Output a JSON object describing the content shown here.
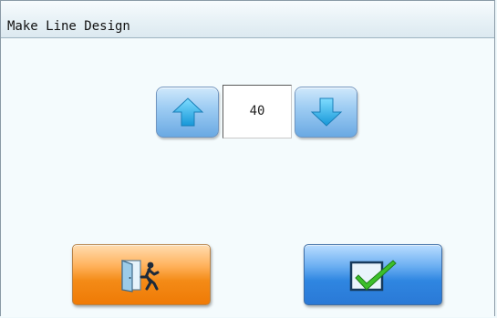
{
  "window": {
    "title": "Make Line Design"
  },
  "stepper": {
    "value": "40",
    "up_icon": "arrow-up-icon",
    "down_icon": "arrow-down-icon"
  },
  "actions": {
    "exit_icon": "exit-door-icon",
    "confirm_icon": "checkmark-icon"
  },
  "colors": {
    "exit_button": "#f48b17",
    "confirm_button": "#2f86e1",
    "arrow_button": "#9fcdf3",
    "check": "#3cbf2a",
    "arrow": "#29aee8"
  }
}
